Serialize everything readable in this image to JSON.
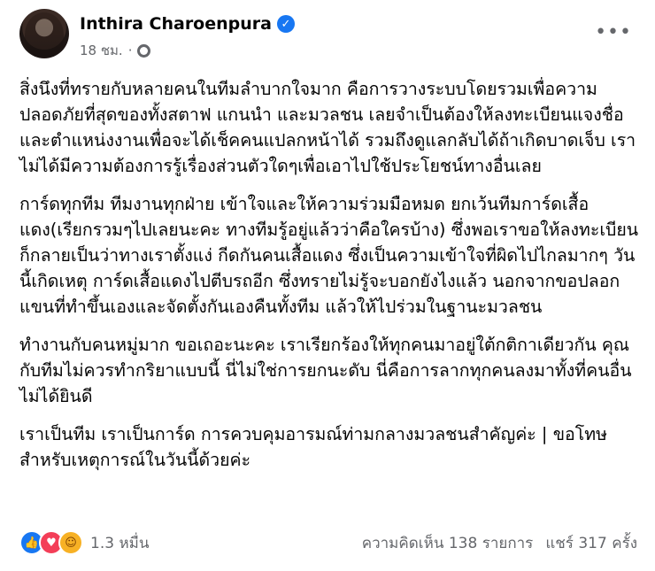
{
  "post": {
    "author": "Inthira Charoenpura",
    "time": "18 ชม.",
    "separator": "·",
    "paragraphs": [
      "สิ่งนึงที่ทรายกับหลายคนในทีมลำบากใจมาก คือการวางระบบโดยรวมเพื่อความปลอดภัยที่สุดของทั้งสตาฟ แกนนำ และมวลชน เลยจำเป็นต้องให้ลงทะเบียนแจงชื่อและตำแหน่งงานเพื่อจะได้เช็คคนแปลกหน้าได้ รวมถึงดูแลกลับได้ถ้าเกิดบาดเจ็บ เราไม่ได้มีความต้องการรู้เรื่องส่วนตัวใดๆเพื่อเอาไปใช้ประโยชน์ทางอื่นเลย",
      "การ์ดทุกทีม ทีมงานทุกฝ่าย เข้าใจและให้ความร่วมมือหมด ยกเว้นทีมการ์ดเสื้อแดง(เรียกรวมๆไปเลยนะคะ ทางทีมรู้อยู่แล้วว่าคือใครบ้าง) ซึ่งพอเราขอให้ลงทะเบียน ก็กลายเป็นว่าทางเราตั้งแง่ กีดกันคนเสื้อแดง ซึ่งเป็นความเข้าใจที่ผิดไปไกลมากๆ วันนี้เกิดเหตุ การ์ดเสื้อแดงไปตีบรถอีก ซึ่งทรายไม่รู้จะบอกยังไงแล้ว นอกจากขอปลอกแขนที่ทำขึ้นเองและจัดตั้งกันเองคืนทั้งทีม แล้วให้ไปร่วมในฐานะมวลชน",
      "ทำงานกับคนหมู่มาก ขอเถอะนะคะ เราเรียกร้องให้ทุกคนมาอยู่ใต้กติกาเดียวกัน คุณกับทีมไม่ควรทำกริยาแบบนี้ นี่ไม่ใช่การยกนะดับ นี่คือการลากทุกคนลงมาทั้งที่คนอื่นไม่ได้ยินดี",
      "เราเป็นทีม เราเป็นการ์ด การควบคุมอารมณ์ท่ามกลางมวลชนสำคัญค่ะ | ขอโทษสำหรับเหตุการณ์ในวันนี้ด้วยค่ะ"
    ],
    "reaction_count": "1.3 หมื่น",
    "comments": "ความคิดเห็น 138 รายการ",
    "shares": "แชร์ 317 ครั้ง"
  },
  "icons": {
    "verified": "verified-badge-icon",
    "privacy": "globe-icon",
    "more": "more-options-icon",
    "reactions": [
      "like-icon",
      "love-icon",
      "care-icon"
    ]
  },
  "colors": {
    "accent": "#1877f2",
    "love": "#f33e58",
    "care": "#f7b125",
    "muted": "#65676b"
  }
}
